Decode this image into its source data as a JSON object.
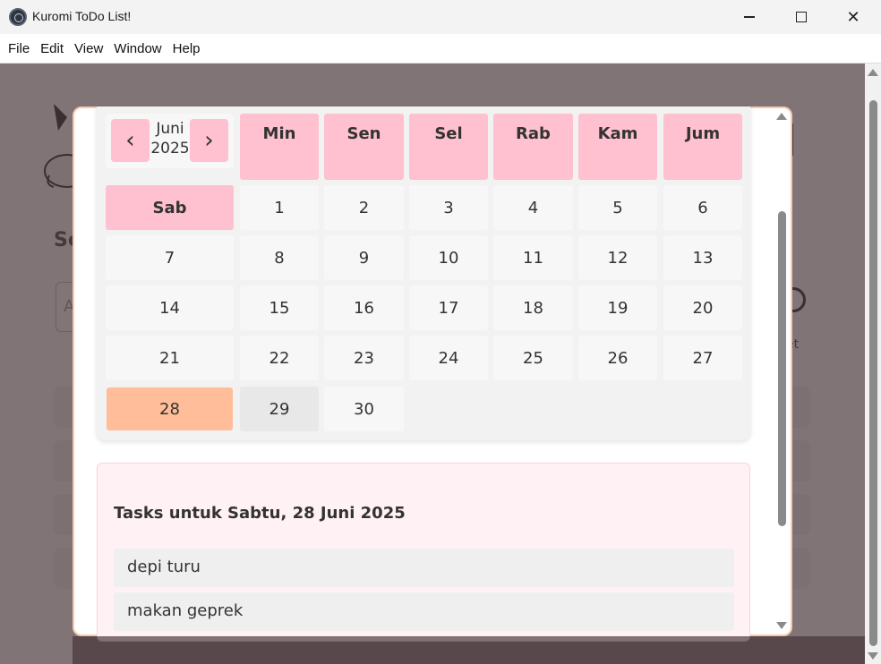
{
  "window": {
    "title": "Kuromi ToDo List!",
    "minimize_glyph": "—",
    "maximize_glyph": "☐",
    "close_glyph": "✕"
  },
  "menu": [
    "File",
    "Edit",
    "View",
    "Window",
    "Help"
  ],
  "background": {
    "heading_partial": "Sc",
    "input_partial": "A",
    "side_label_partial": "et"
  },
  "calendar": {
    "month_label": "Juni",
    "year_label": "2025",
    "prev_glyph": "‹",
    "next_glyph": "›",
    "weekday_headers": [
      "Min",
      "Sen",
      "Sel",
      "Rab",
      "Kam",
      "Jum"
    ],
    "saturday_header": "Sab",
    "days": [
      "1",
      "2",
      "3",
      "4",
      "5",
      "6",
      "7",
      "8",
      "9",
      "10",
      "11",
      "12",
      "13",
      "14",
      "15",
      "16",
      "17",
      "18",
      "19",
      "20",
      "21",
      "22",
      "23",
      "24",
      "25",
      "26",
      "27",
      "28",
      "29",
      "30"
    ],
    "selected_day": "28",
    "hover_day": "29",
    "colors": {
      "header_pink": "#ffc0cf",
      "selected_peach": "#ffbd99",
      "hover_gray": "#e8e8e8"
    }
  },
  "tasks": {
    "title": "Tasks untuk Sabtu, 28 Juni 2025",
    "items": [
      "depi turu",
      "makan geprek"
    ]
  }
}
